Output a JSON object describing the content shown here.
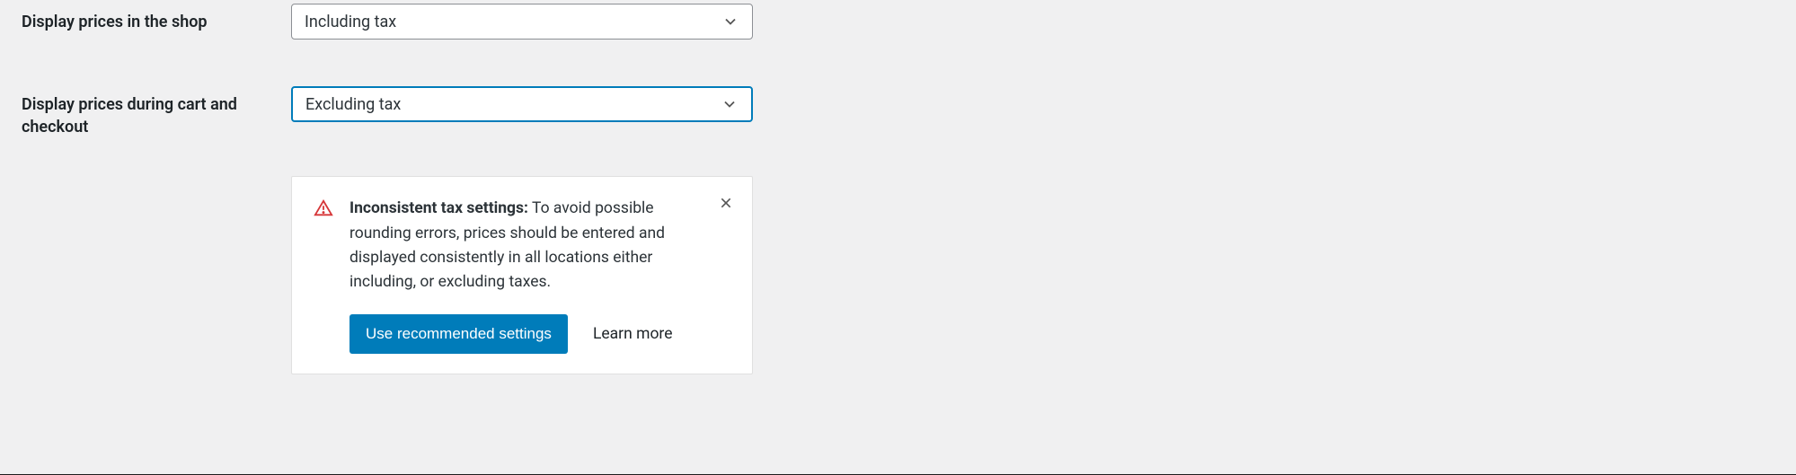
{
  "fields": {
    "shop_prices": {
      "label": "Display prices in the shop",
      "value": "Including tax"
    },
    "cart_prices": {
      "label": "Display prices during cart and checkout",
      "value": "Excluding tax"
    }
  },
  "notice": {
    "title": "Inconsistent tax settings:",
    "body": "To avoid possible rounding errors, prices should be entered and displayed consistently in all locations either including, or excluding taxes.",
    "primary_action": "Use recommended settings",
    "secondary_action": "Learn more"
  },
  "colors": {
    "focus": "#007cba",
    "danger": "#d63638"
  }
}
